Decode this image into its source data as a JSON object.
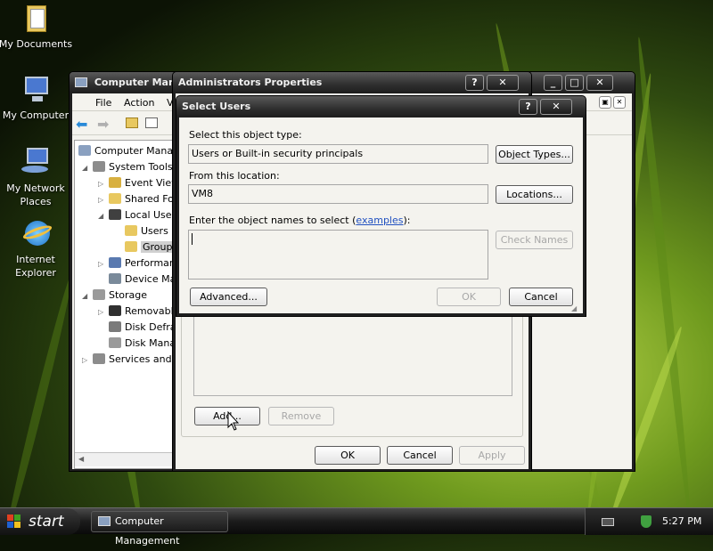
{
  "desktop": {
    "icons": [
      {
        "label": "My Documents"
      },
      {
        "label": "My Computer"
      },
      {
        "label_line1": "My Network",
        "label_line2": "Places"
      },
      {
        "label_line1": "Internet",
        "label_line2": "Explorer"
      }
    ]
  },
  "computer_management": {
    "title": "Computer Manag",
    "menu": [
      "File",
      "Action",
      "V"
    ],
    "tree": [
      "Computer Manag",
      "System Tools",
      "Event View",
      "Shared Fol",
      "Local User",
      "Users",
      "Group",
      "Performan",
      "Device Ma",
      "Storage",
      "Removabl",
      "Disk Defra",
      "Disk Mana",
      "Services and A"
    ]
  },
  "admin_properties": {
    "title": "Administrators Properties",
    "add_label": "Add...",
    "remove_label": "Remove",
    "ok_label": "OK",
    "cancel_label": "Cancel",
    "apply_label": "Apply"
  },
  "select_users": {
    "title": "Select Users",
    "object_type_label": "Select this object type:",
    "object_type_value": "Users or Built-in security principals",
    "object_types_button": "Object Types...",
    "location_label": "From this location:",
    "location_value": "VM8",
    "locations_button": "Locations...",
    "enter_names_label": "Enter the object names to select (",
    "examples_link": "examples",
    "enter_names_suffix": "):",
    "names_value": "",
    "check_names_button": "Check Names",
    "advanced_button": "Advanced...",
    "ok_button": "OK",
    "cancel_button": "Cancel"
  },
  "taskbar": {
    "start_label": "start",
    "task_label": "Computer Management",
    "clock": "5:27 PM"
  }
}
